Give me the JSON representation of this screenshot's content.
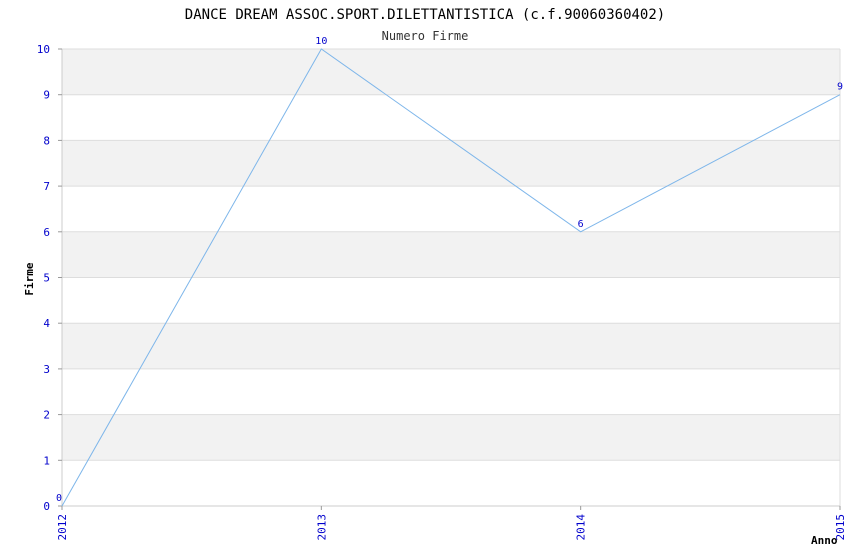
{
  "chart_data": {
    "type": "line",
    "title": "DANCE DREAM ASSOC.SPORT.DILETTANTISTICA (c.f.90060360402)",
    "subtitle": "Numero Firme",
    "xlabel": "Anno",
    "ylabel": "Firme",
    "categories": [
      "2012",
      "2013",
      "2014",
      "2015"
    ],
    "series": [
      {
        "values": [
          0,
          10,
          6,
          9
        ],
        "labels": [
          "0",
          "10",
          "6",
          "9"
        ]
      }
    ],
    "ylim": [
      0,
      10
    ],
    "yticks": [
      "0",
      "1",
      "2",
      "3",
      "4",
      "5",
      "6",
      "7",
      "8",
      "9",
      "10"
    ],
    "grid": true,
    "colors": {
      "line": "#7eb6ea",
      "band": "#f2f2f2",
      "grid": "#dddddd",
      "tick": "#0000cc"
    }
  }
}
